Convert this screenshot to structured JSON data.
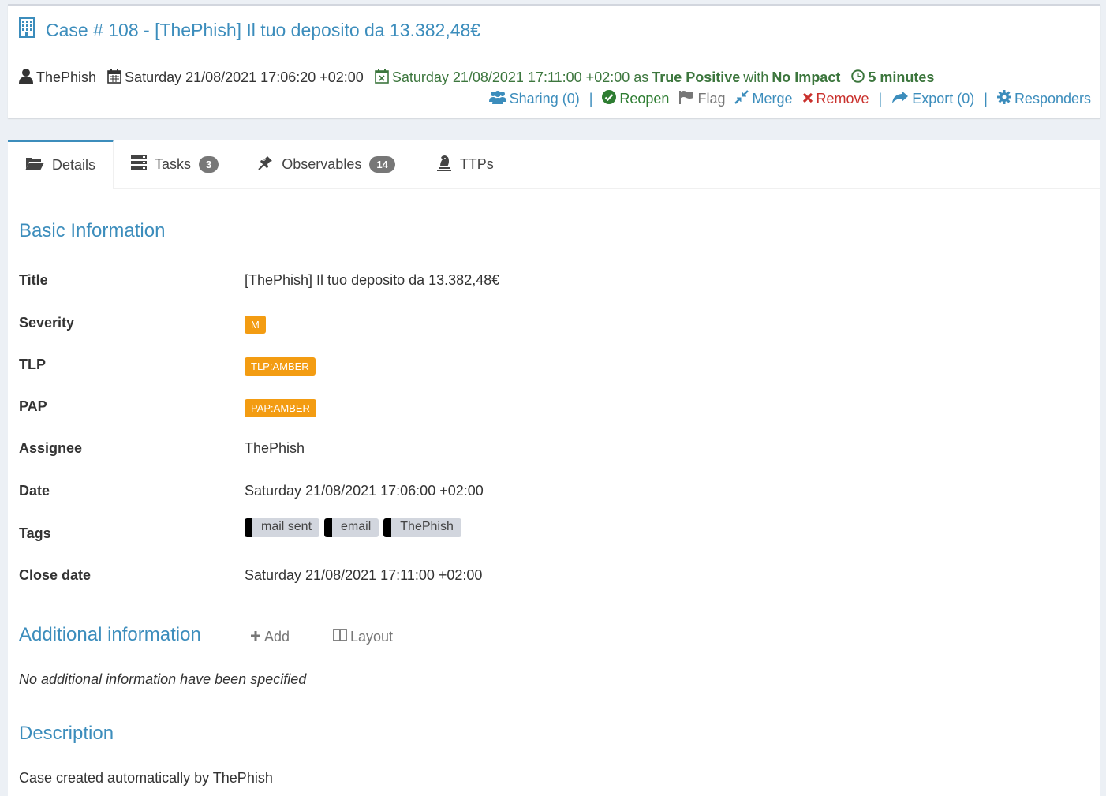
{
  "header": {
    "title": "Case # 108 - [ThePhish] Il tuo deposito da 13.382,48€",
    "owner": "ThePhish",
    "created": "Saturday 21/08/2021 17:06:20 +02:00",
    "closed_prefix": "Saturday 21/08/2021 17:11:00 +02:00 as",
    "resolution": "True Positive",
    "with_word": "with",
    "impact": "No Impact",
    "duration": "5 minutes"
  },
  "actions": {
    "sharing": "Sharing (0)",
    "reopen": "Reopen",
    "flag": "Flag",
    "merge": "Merge",
    "remove": "Remove",
    "export": "Export (0)",
    "responders": "Responders",
    "separator": "|"
  },
  "tabs": [
    {
      "label": "Details"
    },
    {
      "label": "Tasks",
      "count": "3"
    },
    {
      "label": "Observables",
      "count": "14"
    },
    {
      "label": "TTPs"
    }
  ],
  "basic_info": {
    "heading": "Basic Information",
    "title_label": "Title",
    "title_value": "[ThePhish] Il tuo deposito da 13.382,48€",
    "severity_label": "Severity",
    "severity_value": "M",
    "tlp_label": "TLP",
    "tlp_value": "TLP:AMBER",
    "pap_label": "PAP",
    "pap_value": "PAP:AMBER",
    "assignee_label": "Assignee",
    "assignee_value": "ThePhish",
    "date_label": "Date",
    "date_value": "Saturday 21/08/2021 17:06:00 +02:00",
    "tags_label": "Tags",
    "tags": [
      "mail sent",
      "email",
      "ThePhish"
    ],
    "close_date_label": "Close date",
    "close_date_value": "Saturday 21/08/2021 17:11:00 +02:00"
  },
  "additional_info": {
    "heading": "Additional information",
    "add_label": "Add",
    "layout_label": "Layout",
    "empty_text": "No additional information have been specified"
  },
  "description": {
    "heading": "Description",
    "text": "Case created automatically by ThePhish"
  },
  "colors": {
    "accent": "#3c8dbc",
    "success": "#3c763d",
    "danger": "#c9302c",
    "amber": "#f39c12"
  }
}
